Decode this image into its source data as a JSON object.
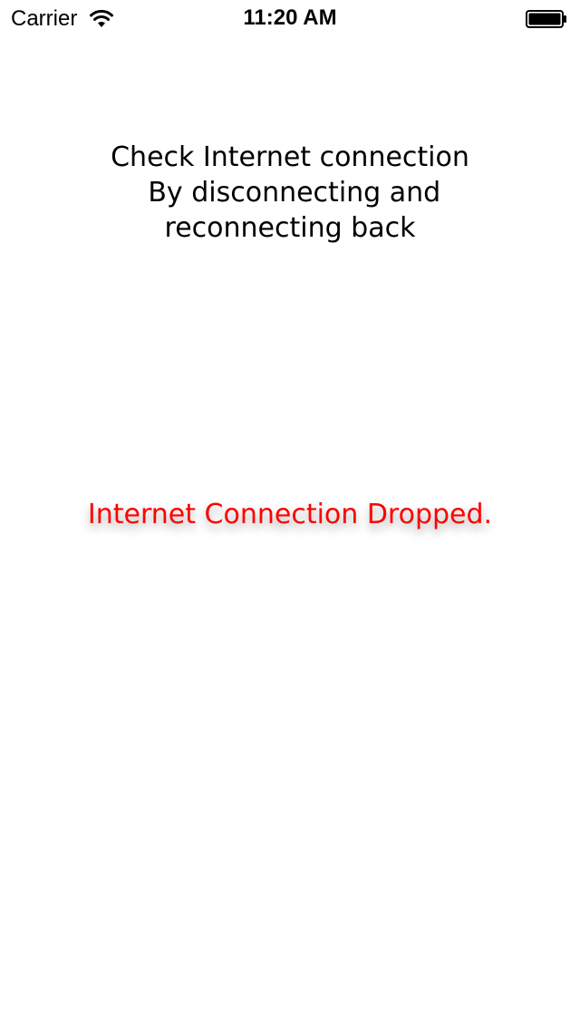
{
  "status_bar": {
    "carrier": "Carrier",
    "time": "11:20 AM",
    "wifi_icon": "wifi-icon",
    "battery_icon": "battery-full-icon"
  },
  "main": {
    "instruction_lines": [
      "Check Internet connection",
      " By disconnecting and",
      "reconnecting back"
    ],
    "status_message": "Internet Connection Dropped.",
    "status_color": "#ff0000"
  }
}
